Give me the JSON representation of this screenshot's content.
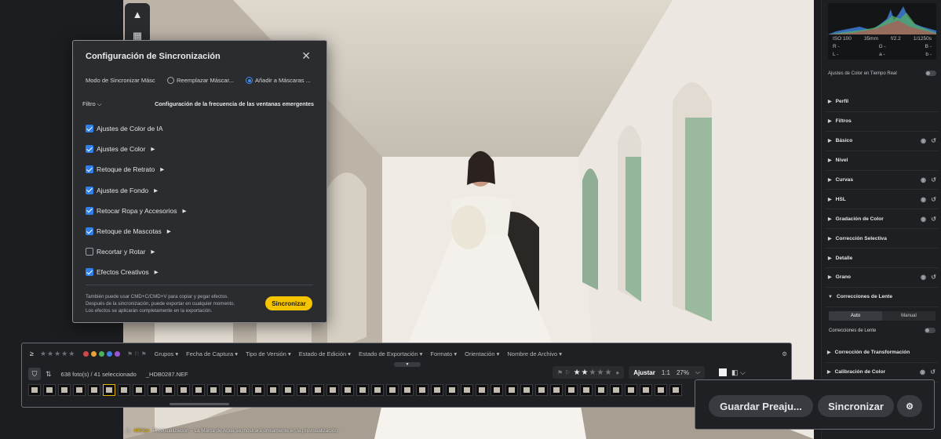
{
  "dialog": {
    "title": "Configuración de Sincronización",
    "mode_label": "Modo de Sincronizar Másc",
    "mode_options": [
      "Reemplazar Máscar...",
      "Añadir a Máscaras ..."
    ],
    "filter_label": "Filtro",
    "frequency_label": "Configuración de la frecuencia de las ventanas emergentes",
    "options": [
      {
        "label": "Ajustes de Color de IA",
        "checked": true,
        "expandable": false
      },
      {
        "label": "Ajustes de Color",
        "checked": true,
        "expandable": true
      },
      {
        "label": "Retoque de Retrato",
        "checked": true,
        "expandable": true
      },
      {
        "label": "Ajustes de Fondo",
        "checked": true,
        "expandable": true
      },
      {
        "label": "Retocar Ropa y Accesorios",
        "checked": true,
        "expandable": true
      },
      {
        "label": "Retoque de Mascotas",
        "checked": true,
        "expandable": true
      },
      {
        "label": "Recortar y Rotar",
        "checked": false,
        "expandable": true
      },
      {
        "label": "Efectos Creativos",
        "checked": true,
        "expandable": true
      }
    ],
    "note_lines": [
      "También puede usar CMD+C/CMD+V para copiar y pegar efectos.",
      "Después de la sincronización, puede exportar en cualquier momento.",
      "Los efectos se aplicarán completamente en la exportación."
    ],
    "sync_button": "Sincronizar"
  },
  "filmstrip": {
    "color_labels": [
      "#d04848",
      "#e8a33a",
      "#4fb05a",
      "#3e7fe0",
      "#9a55d2"
    ],
    "categories": [
      "Grupos",
      "Fecha de Captura",
      "Tipo de Versión",
      "Estado de Edición",
      "Estado de Exportación",
      "Formato",
      "Orientación",
      "Nombre de Archivo"
    ],
    "count": "638 foto(s) / 41 seleccionado",
    "filename": "_HDB0287.NEF",
    "fit_label": "Ajustar",
    "ratio_label": "1:1",
    "zoom": "27%"
  },
  "right_panel": {
    "exif": {
      "iso": "ISO 100",
      "focal": "35mm",
      "aperture": "f/2.2",
      "shutter": "1/1250s",
      "r": "R -",
      "g": "G -",
      "b": "B -",
      "l": "L -",
      "a": "a -",
      "bb": "b -"
    },
    "realtime_label": "Ajustes de Color en Tiempo Real",
    "sections": [
      {
        "label": "Perfil",
        "open": false,
        "icons": false
      },
      {
        "label": "Filtros",
        "open": false,
        "icons": false
      },
      {
        "label": "Básico",
        "open": false,
        "icons": true
      },
      {
        "label": "Nivel",
        "open": false,
        "icons": false
      },
      {
        "label": "Curvas",
        "open": false,
        "icons": true
      },
      {
        "label": "HSL",
        "open": false,
        "icons": true
      },
      {
        "label": "Gradación de Color",
        "open": false,
        "icons": true
      },
      {
        "label": "Corrección Selectiva",
        "open": false,
        "icons": false
      },
      {
        "label": "Detalle",
        "open": false,
        "icons": false
      },
      {
        "label": "Grano",
        "open": false,
        "icons": true
      },
      {
        "label": "Correcciones de Lente",
        "open": true,
        "icons": false
      }
    ],
    "lens_tabs": [
      "Auto",
      "Manual"
    ],
    "lens_toggle_label": "Correcciones de Lente",
    "sections_after": [
      {
        "label": "Corrección de Transformación",
        "icons": false
      },
      {
        "label": "Calibración de Color",
        "icons": true
      }
    ]
  },
  "actions": {
    "save_preset": "Guardar Preaju...",
    "sync": "Sincronizar"
  },
  "footer": {
    "resolution": "4000px",
    "text": "Previsualización – La Marca de Agua se mostrará únicamente en la previsualización."
  }
}
